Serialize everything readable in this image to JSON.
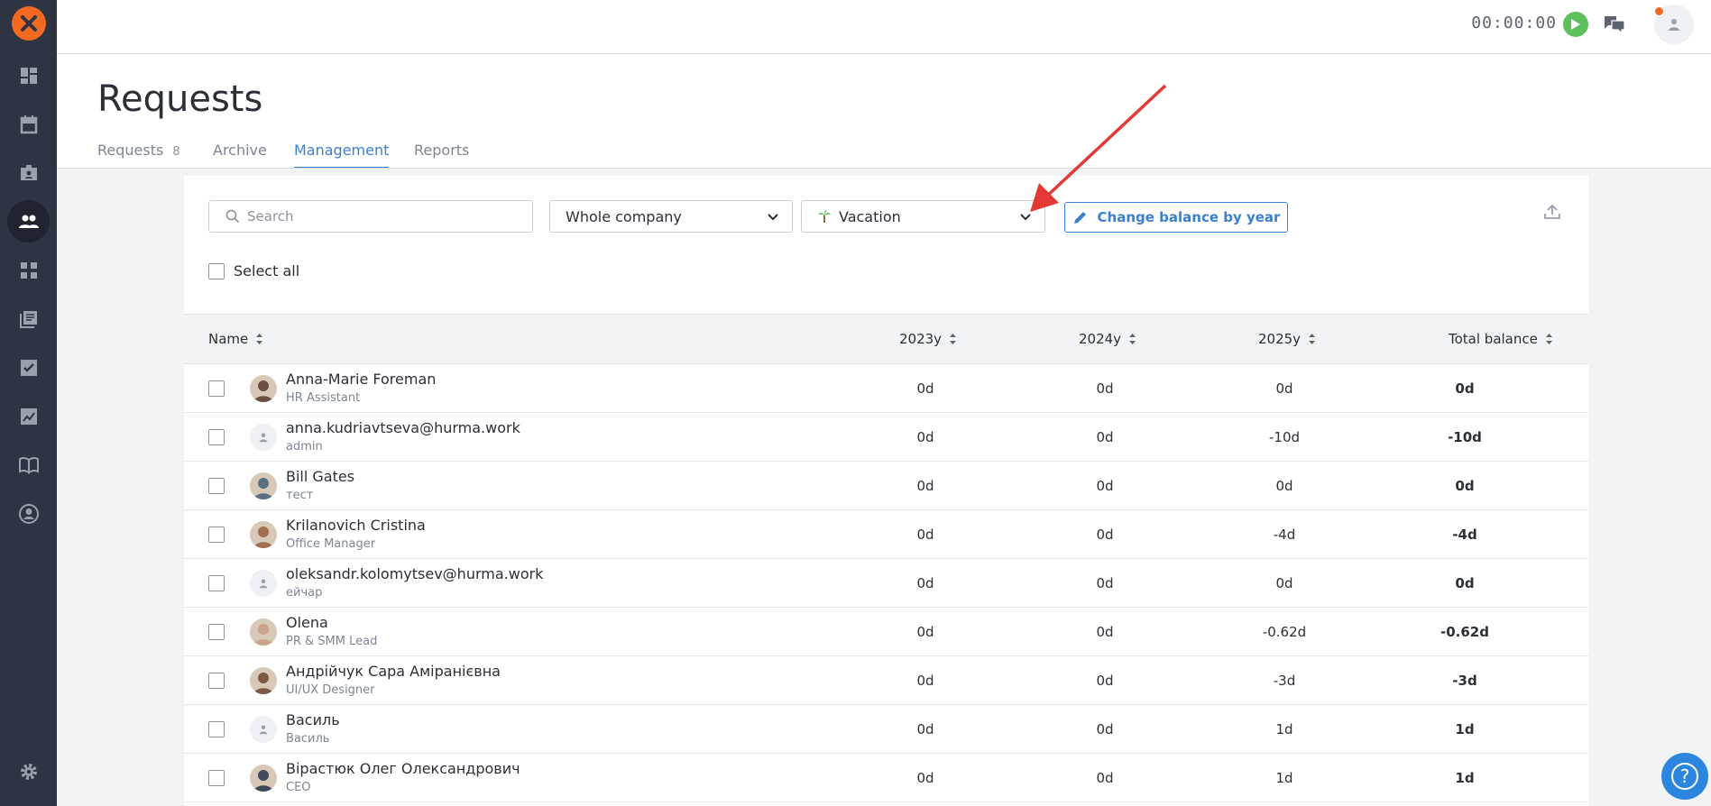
{
  "header": {
    "timer": "00:00:00"
  },
  "page": {
    "title": "Requests"
  },
  "tabs": [
    {
      "label": "Requests",
      "count": "8"
    },
    {
      "label": "Archive"
    },
    {
      "label": "Management"
    },
    {
      "label": "Reports"
    }
  ],
  "filters": {
    "search_placeholder": "Search",
    "department": "Whole company",
    "leave_type": "Vacation",
    "change_balance_label": "Change balance by year",
    "select_all_label": "Select all"
  },
  "table": {
    "columns": [
      "Name",
      "2023y",
      "2024y",
      "2025y",
      "Total balance"
    ],
    "rows": [
      {
        "name": "Anna-Marie Foreman",
        "role": "HR Assistant",
        "y2023": "0d",
        "y2024": "0d",
        "y2025": "0d",
        "total": "0d",
        "avatar": "photo"
      },
      {
        "name": "anna.kudriavtseva@hurma.work",
        "role": "admin",
        "y2023": "0d",
        "y2024": "0d",
        "y2025": "-10d",
        "total": "-10d",
        "avatar": "placeholder"
      },
      {
        "name": "Bill Gates",
        "role": "тест",
        "y2023": "0d",
        "y2024": "0d",
        "y2025": "0d",
        "total": "0d",
        "avatar": "photo"
      },
      {
        "name": "Krilanovich Cristina",
        "role": "Office Manager",
        "y2023": "0d",
        "y2024": "0d",
        "y2025": "-4d",
        "total": "-4d",
        "avatar": "photo"
      },
      {
        "name": "oleksandr.kolomytsev@hurma.work",
        "role": "ейчар",
        "y2023": "0d",
        "y2024": "0d",
        "y2025": "0d",
        "total": "0d",
        "avatar": "placeholder"
      },
      {
        "name": "Olena",
        "role": "PR & SMM Lead",
        "y2023": "0d",
        "y2024": "0d",
        "y2025": "-0.62d",
        "total": "-0.62d",
        "avatar": "photo"
      },
      {
        "name": "Андрійчук Сара Аміранієвна",
        "role": "UI/UX Designer",
        "y2023": "0d",
        "y2024": "0d",
        "y2025": "-3d",
        "total": "-3d",
        "avatar": "photo"
      },
      {
        "name": "Василь",
        "role": "Василь",
        "y2023": "0d",
        "y2024": "0d",
        "y2025": "1d",
        "total": "1d",
        "avatar": "placeholder"
      },
      {
        "name": "Вірастюк Олег Олександрович",
        "role": "CEO",
        "y2023": "0d",
        "y2024": "0d",
        "y2025": "1d",
        "total": "1d",
        "avatar": "photo"
      }
    ]
  },
  "colors": {
    "sidebar": "#2e3442",
    "accent": "#3a80d0",
    "brand": "#f26a21",
    "timer_play": "#5cc15a",
    "annotation_arrow": "#e53935"
  }
}
